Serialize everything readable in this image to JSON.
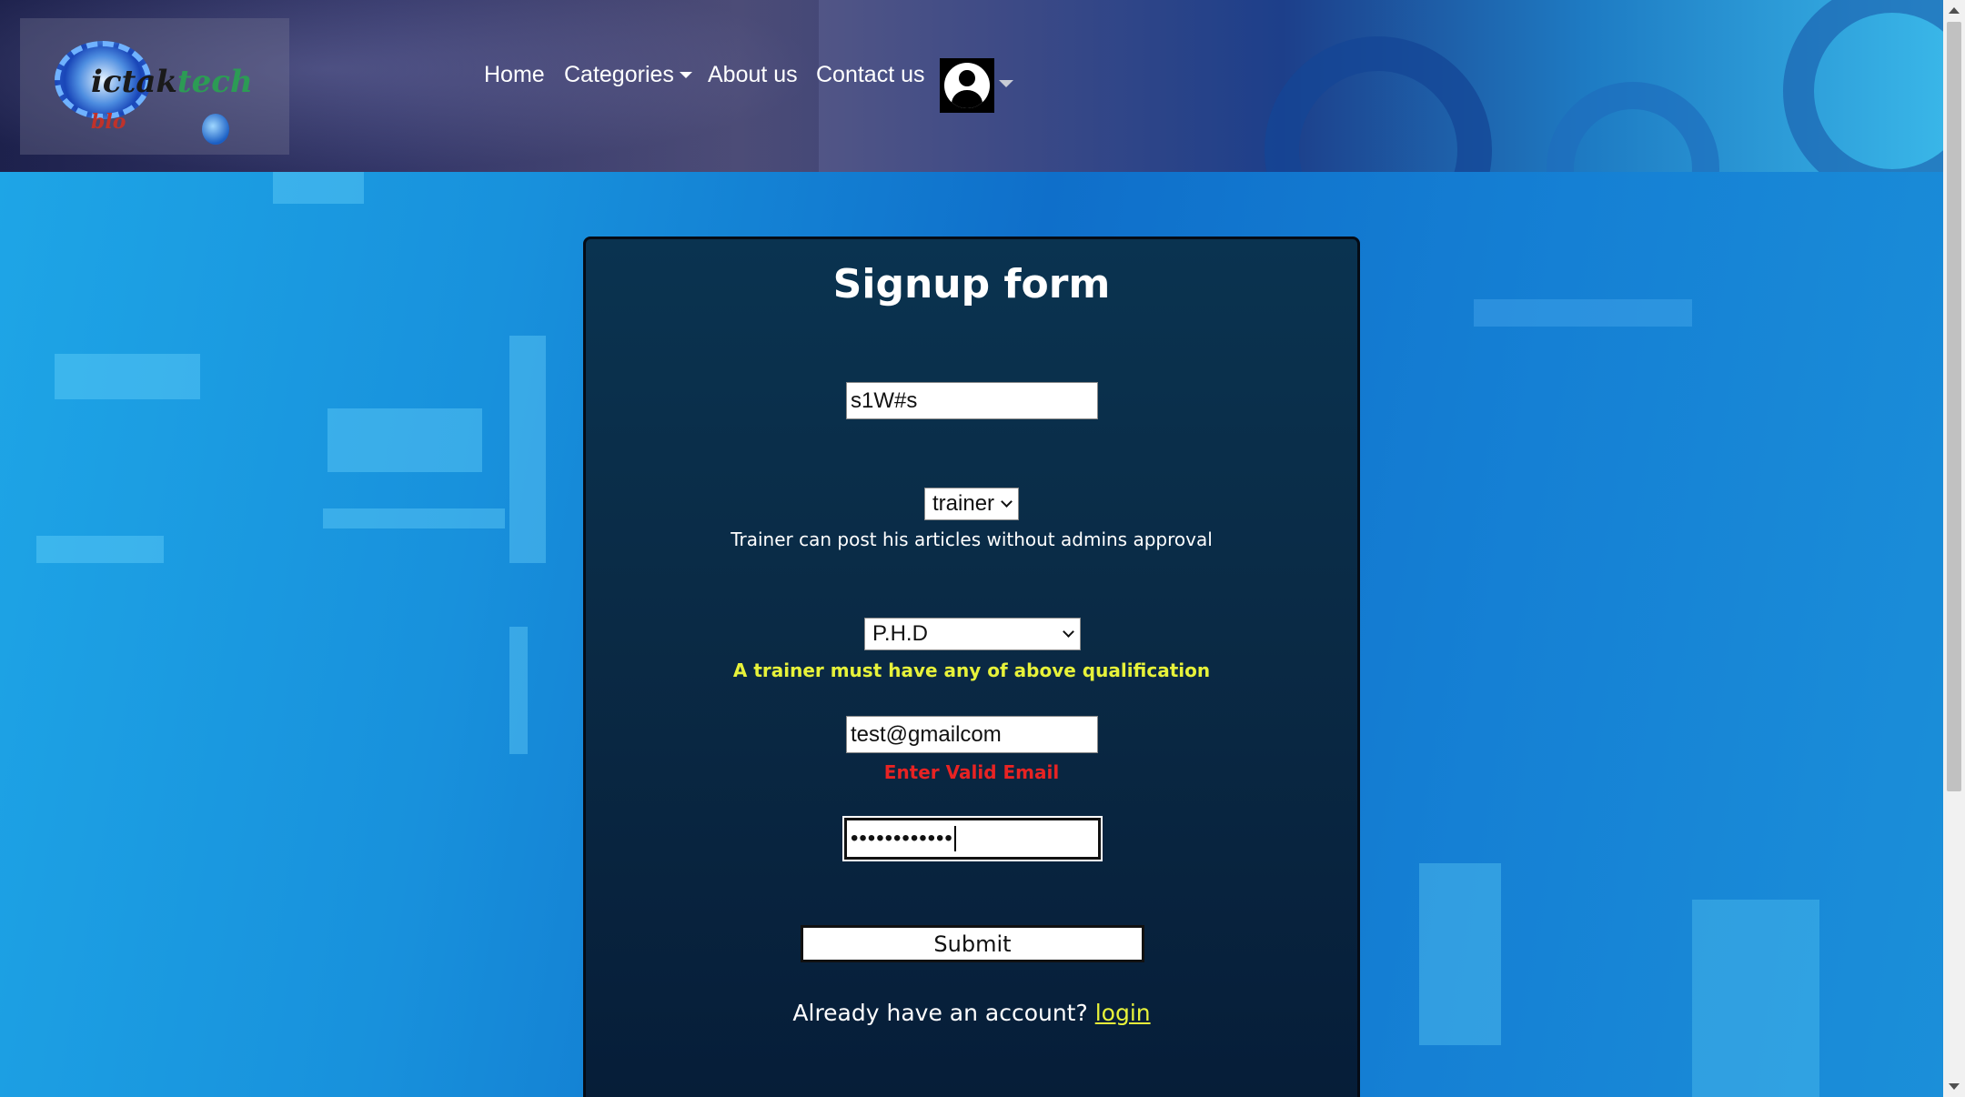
{
  "header": {
    "logo": {
      "text_part1": "ictak",
      "text_part2": "tech",
      "text_part3": "blo"
    },
    "nav": {
      "home": "Home",
      "categories": "Categories",
      "about": "About us",
      "contact": "Contact us"
    },
    "profile_icon": "user-avatar-icon"
  },
  "form": {
    "title": "Signup form",
    "username_value": "s1W#s",
    "role_value": "trainer",
    "role_note": "Trainer can post his articles without admins approval",
    "qualification_value": "P.H.D",
    "qualification_note": "A trainer must have any of above qualification",
    "email_value": "test@gmailcom",
    "email_error": "Enter Valid Email",
    "password_value": "••••••••••••",
    "submit_label": "Submit",
    "login_prompt": "Already have an account?",
    "login_link": "login"
  },
  "colors": {
    "accent_yellow": "#e7f23a",
    "error_red": "#e82323",
    "panel_bg": "#0a2a45"
  }
}
